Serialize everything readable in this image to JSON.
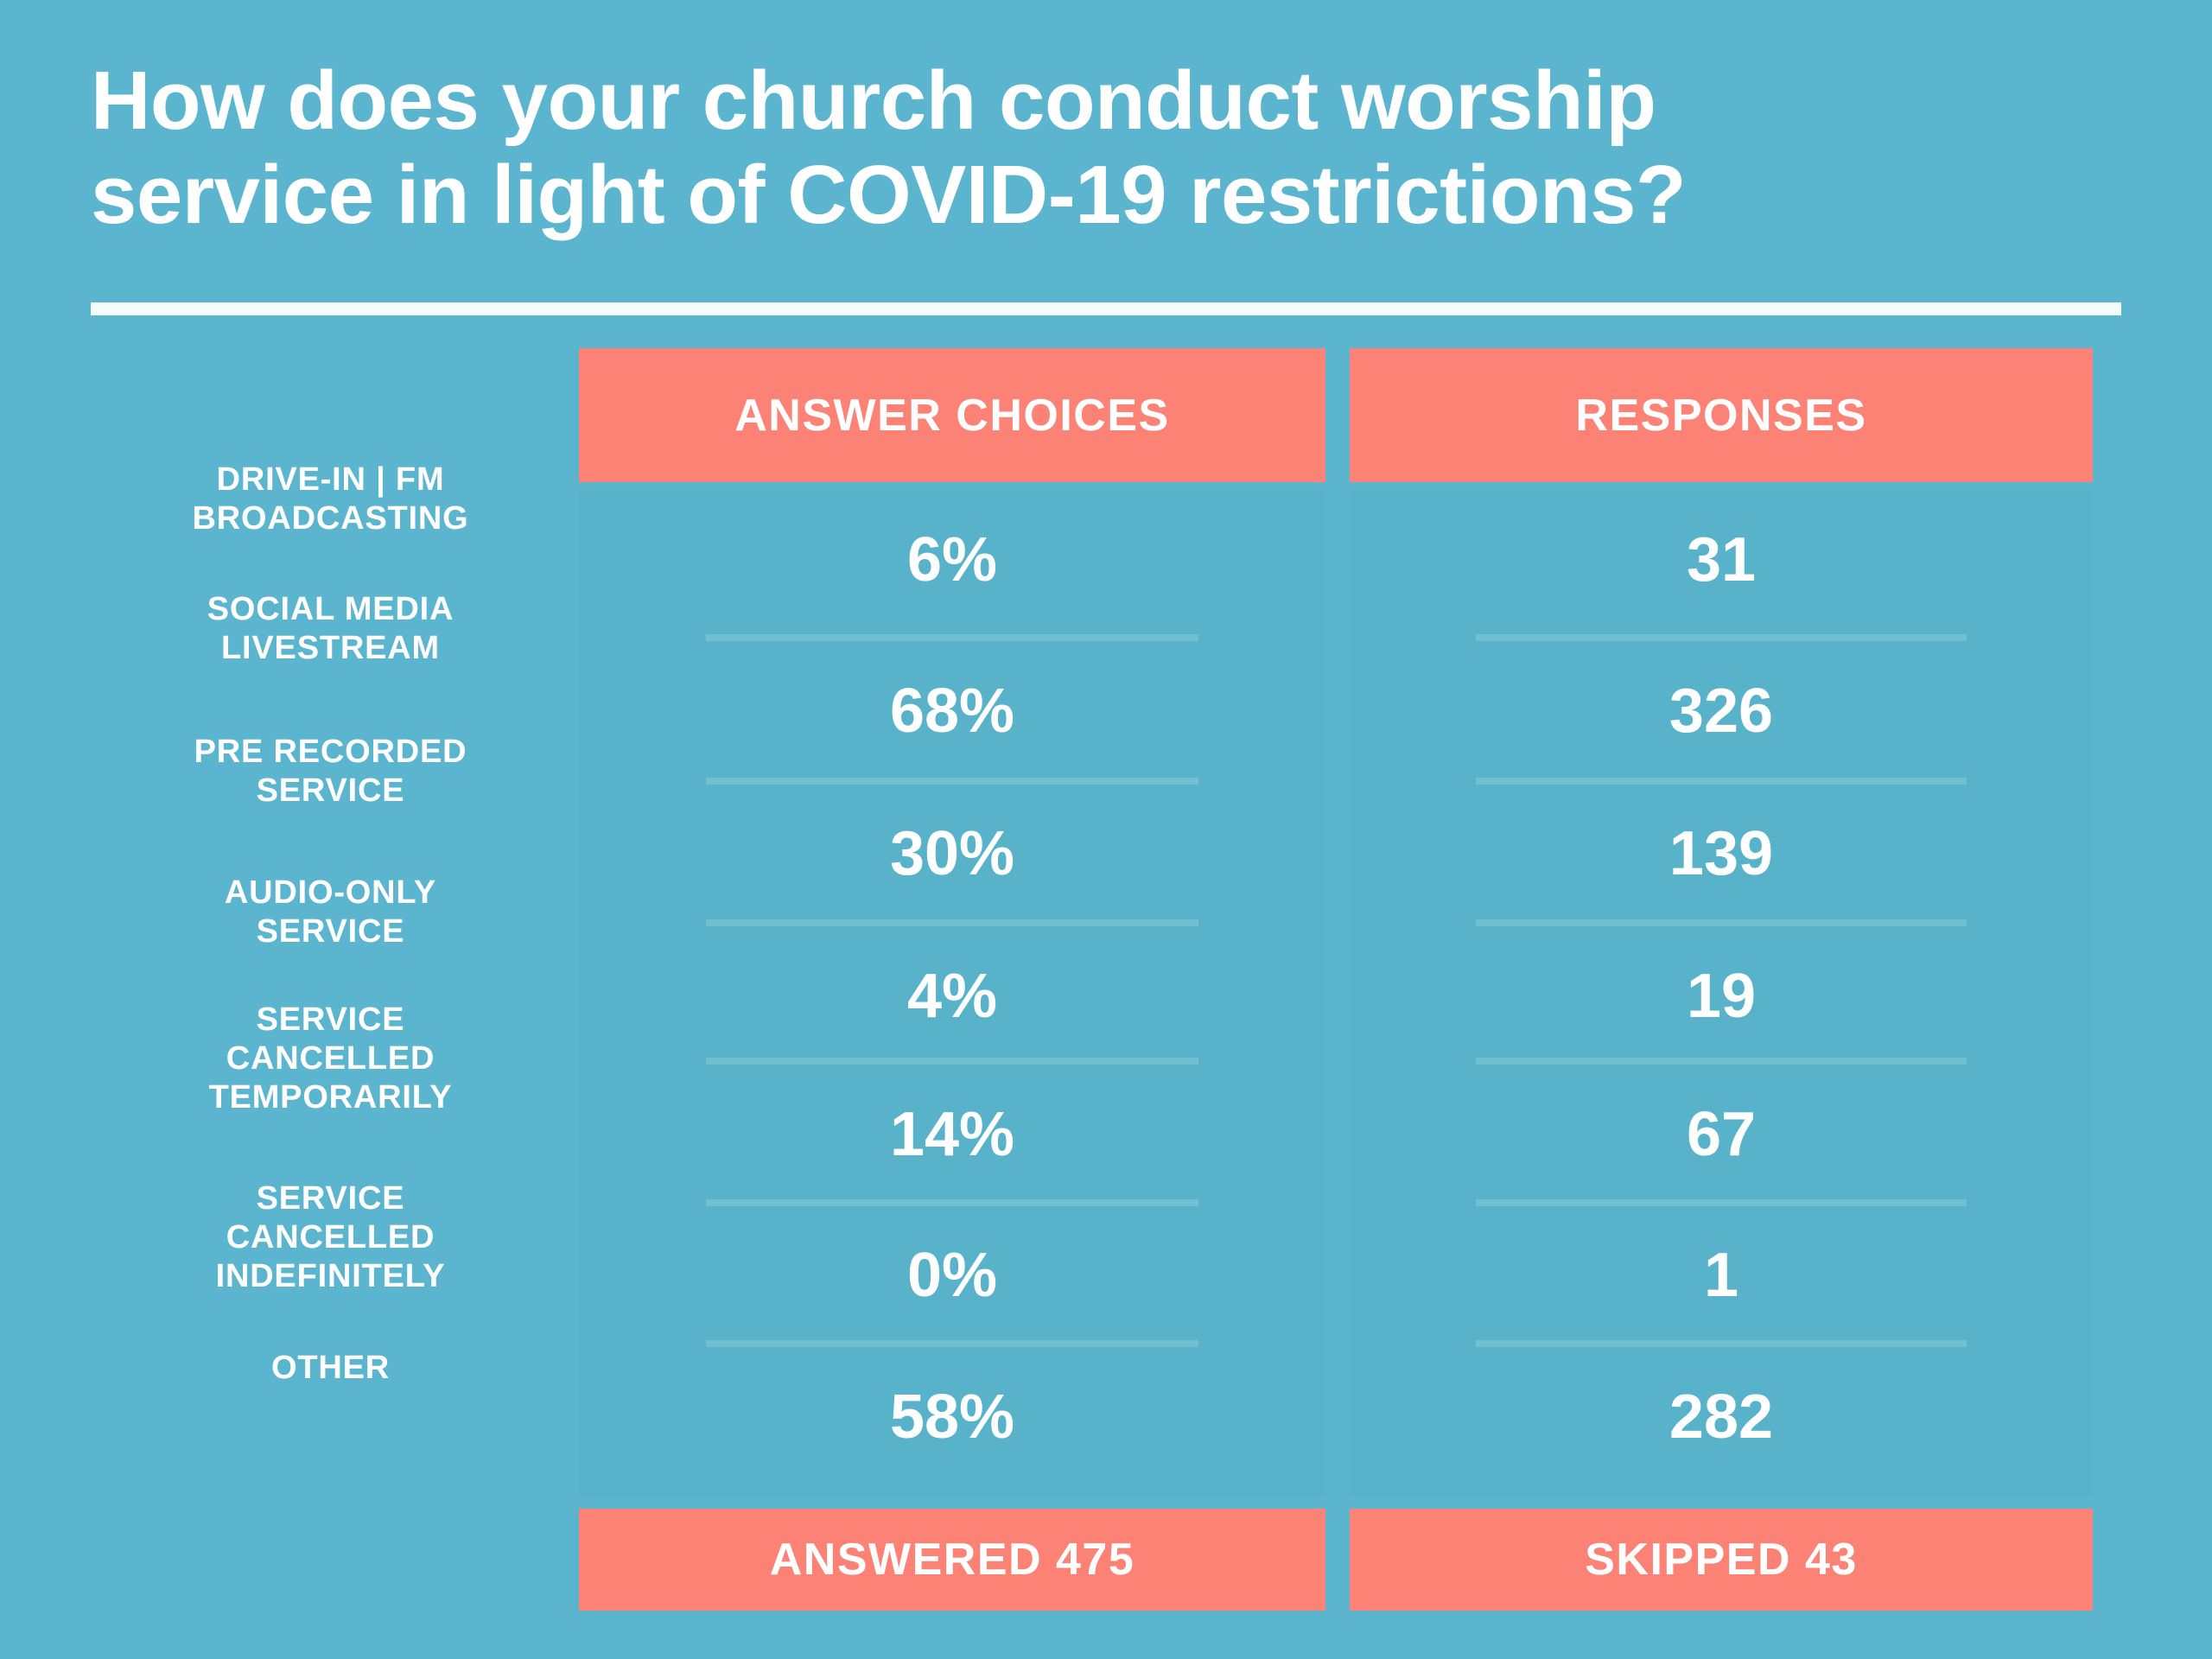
{
  "title": "How does your church conduct worship\nservice in light of COVID-19 restrictions?",
  "colors": {
    "background": "#5BB5CE",
    "accent": "#FC8276",
    "text": "#FFFFFF",
    "rule": "#F4FBFB"
  },
  "table": {
    "headers": {
      "choices": "ANSWER CHOICES",
      "responses": "RESPONSES"
    },
    "footer": {
      "answered": "ANSWERED 475",
      "skipped": "SKIPPED 43"
    }
  },
  "chart_data": {
    "type": "table",
    "title": "How does your church conduct worship service in light of COVID-19 restrictions?",
    "columns": [
      "ANSWER CHOICES",
      "RESPONSES"
    ],
    "categories": [
      "DRIVE-IN | FM BROADCASTING",
      "SOCIAL MEDIA LIVESTREAM",
      "PRE RECORDED SERVICE",
      "AUDIO-ONLY SERVICE",
      "SERVICE CANCELLED TEMPORARILY",
      "SERVICE CANCELLED INDEFINITELY",
      "OTHER"
    ],
    "series": [
      {
        "name": "ANSWER CHOICES",
        "values": [
          6,
          68,
          30,
          4,
          14,
          0,
          58
        ],
        "unit": "%"
      },
      {
        "name": "RESPONSES",
        "values": [
          31,
          326,
          139,
          19,
          67,
          1,
          282
        ],
        "unit": "count"
      }
    ],
    "answered": 475,
    "skipped": 43
  },
  "rows": [
    {
      "label": "DRIVE-IN | FM\nBROADCASTING",
      "percent": "6%",
      "responses": "31"
    },
    {
      "label": "SOCIAL MEDIA\nLIVESTREAM",
      "percent": "68%",
      "responses": "326"
    },
    {
      "label": "PRE RECORDED\nSERVICE",
      "percent": "30%",
      "responses": "139"
    },
    {
      "label": "AUDIO-ONLY\nSERVICE",
      "percent": "4%",
      "responses": "19"
    },
    {
      "label": "SERVICE\nCANCELLED\nTEMPORARILY",
      "percent": "14%",
      "responses": "67"
    },
    {
      "label": "SERVICE\nCANCELLED\nINDEFINITELY",
      "percent": "0%",
      "responses": "1"
    },
    {
      "label": "OTHER",
      "percent": "58%",
      "responses": "282"
    }
  ]
}
